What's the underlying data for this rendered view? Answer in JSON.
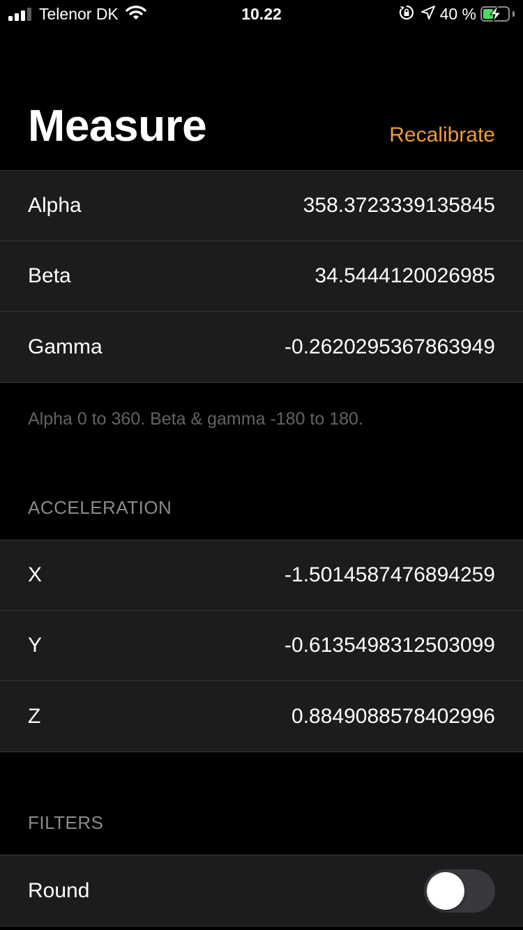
{
  "status_bar": {
    "carrier": "Telenor DK",
    "time": "10.22",
    "battery_percent_label": "40 %",
    "battery_level": 0.4,
    "signal_bars": 3,
    "icons": [
      "signal-icon",
      "wifi-icon",
      "orientation-lock-icon",
      "location-arrow-icon",
      "battery-charging-icon"
    ],
    "battery_color": "#4cd964"
  },
  "header": {
    "title": "Measure",
    "action_label": "Recalibrate",
    "accent_color": "#f09a37"
  },
  "orientation": {
    "rows": [
      {
        "label": "Alpha",
        "value": "358.3723339135845"
      },
      {
        "label": "Beta",
        "value": "34.5444120026985"
      },
      {
        "label": "Gamma",
        "value": "-0.2620295367863949"
      }
    ],
    "footer": "Alpha 0 to 360. Beta & gamma -180 to 180."
  },
  "acceleration": {
    "header": "ACCELERATION",
    "rows": [
      {
        "label": "X",
        "value": "-1.5014587476894259"
      },
      {
        "label": "Y",
        "value": "-0.6135498312503099"
      },
      {
        "label": "Z",
        "value": "0.8849088578402996"
      }
    ]
  },
  "filters": {
    "header": "FILTERS",
    "rows": [
      {
        "label": "Round",
        "toggle_on": false
      }
    ]
  }
}
